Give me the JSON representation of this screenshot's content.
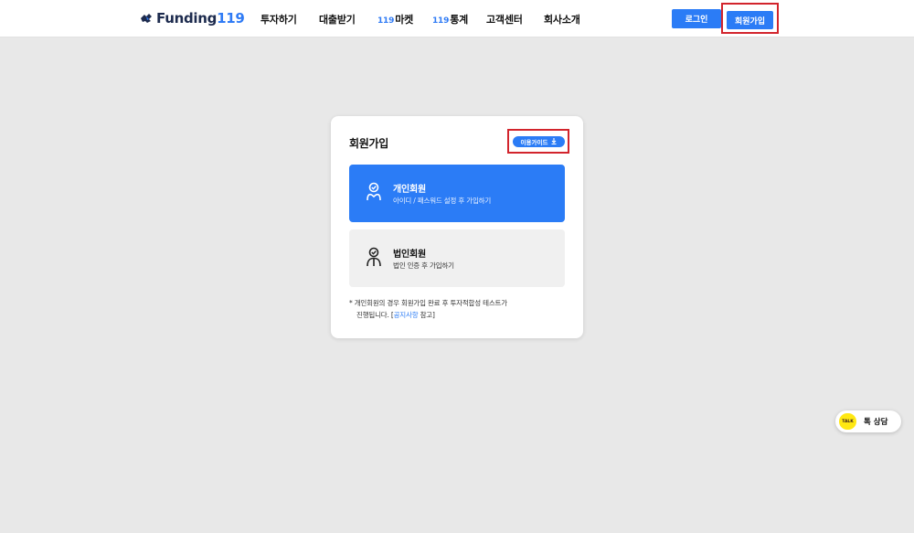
{
  "header": {
    "logo": {
      "text": "Funding",
      "number": "119"
    },
    "nav": [
      {
        "label": "투자하기"
      },
      {
        "label": "대출받기"
      },
      {
        "prefix": "119",
        "label": "마켓"
      },
      {
        "prefix": "119",
        "label": "통계"
      },
      {
        "label": "고객센터"
      },
      {
        "label": "회사소개"
      }
    ],
    "login_label": "로그인",
    "join_label": "회원가입"
  },
  "card": {
    "title": "회원가입",
    "guide_label": "이용가이드",
    "guide_icon": "download-icon",
    "options": [
      {
        "title": "개인회원",
        "subtitle": "아이디 / 패스워드 설정 후 가입하기",
        "icon": "person-icon"
      },
      {
        "title": "법인회원",
        "subtitle": "법인 인증 후 가입하기",
        "icon": "corporate-person-icon"
      }
    ],
    "note": {
      "line1": "* 개인회원의 경우 회원가입 완료 후 투자적합성 테스트가",
      "line2_prefix": "진행됩니다. [",
      "line2_link": "공지사항",
      "line2_suffix": " 참고]"
    }
  },
  "talk": {
    "badge": "TALK",
    "label": "톡 상담"
  },
  "colors": {
    "accent": "#2b7cf6",
    "highlight": "#d2242c",
    "kakao": "#ffe812"
  }
}
